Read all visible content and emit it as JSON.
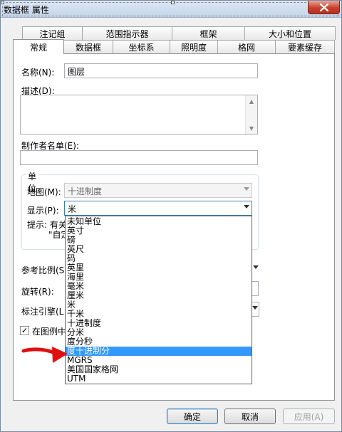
{
  "window": {
    "title": "数据框 属性"
  },
  "tabs": {
    "row_back": [
      "注记组",
      "范围指示器",
      "框架",
      "大小和位置"
    ],
    "row_front": [
      "常规",
      "数据框",
      "坐标系",
      "照明度",
      "格网",
      "要素缓存"
    ],
    "active": "常规"
  },
  "general": {
    "name_label": "名称(N):",
    "name_value": "图层",
    "description_label": "描述(D):",
    "credits_label": "制作者名单(E):",
    "units_group": "单位",
    "map_label": "地图(M):",
    "map_value": "十进制度",
    "display_label": "显示(P):",
    "display_value": "米",
    "tip_prefix": "提示: 有关",
    "tip_line2": "\"自定",
    "ref_scale_label": "参考比例(S",
    "rotation_label": "旋转(R):",
    "label_engine_label": "标注引擎(L",
    "legend_check_label": "在图例中"
  },
  "display_options": [
    "未知单位",
    "英寸",
    "磅",
    "英尺",
    "码",
    "英里",
    "海里",
    "毫米",
    "厘米",
    "米",
    "千米",
    "十进制度",
    "分米",
    "度分秒",
    "度十进制分",
    "MGRS",
    "美国国家格网",
    "UTM"
  ],
  "display_highlight_index": 14,
  "buttons": {
    "ok": "确定",
    "cancel": "取消",
    "apply": "应用(A)"
  },
  "colors": {
    "highlight": "#3399ff",
    "annotation_arrow": "#e01010"
  }
}
